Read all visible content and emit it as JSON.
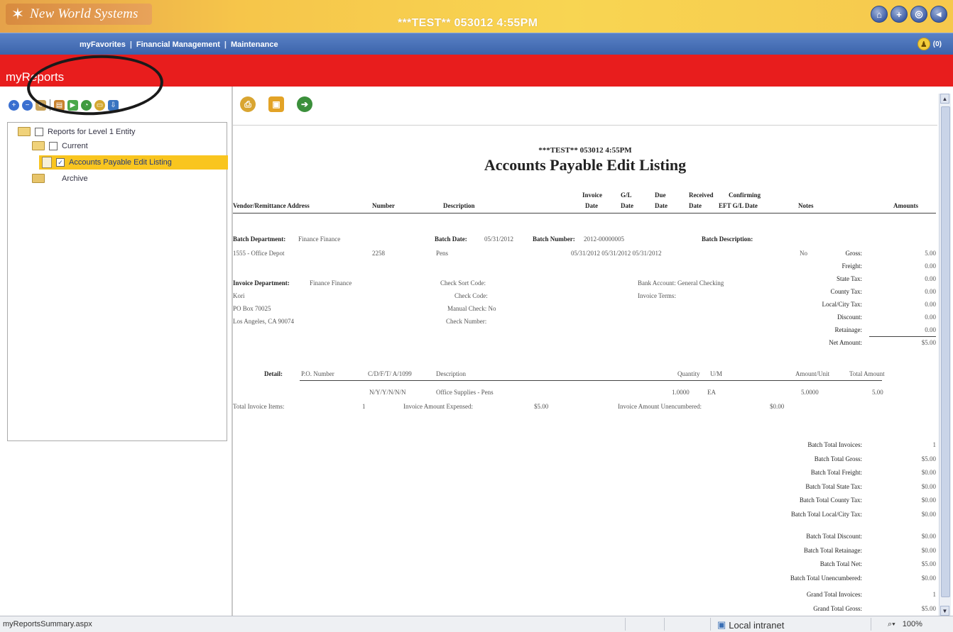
{
  "app": {
    "logo_text": "New World Systems",
    "banner_title": "***TEST** 053012 4:55PM",
    "top_icons": [
      "home-icon",
      "add-icon",
      "globe-icon",
      "back-icon"
    ]
  },
  "nav": {
    "links": [
      "myFavorites",
      "Financial Management",
      "Maintenance"
    ],
    "separator": "|",
    "badge_count": "(0)"
  },
  "section_title": "myReports",
  "tree": {
    "root_label": "Reports for Level 1 Entity",
    "current_label": "Current",
    "selected_report": "Accounts Payable Edit Listing",
    "archive_label": "Archive"
  },
  "report": {
    "test_stamp": "***TEST** 053012 4:55PM",
    "title": "Accounts Payable Edit Listing",
    "columns": {
      "vendor": "Vendor/Remittance Address",
      "number": "Number",
      "description": "Description",
      "invoice_date_1": "Invoice",
      "invoice_date_2": "Date",
      "gl_date_1": "G/L",
      "gl_date_2": "Date",
      "due_date_1": "Due",
      "due_date_2": "Date",
      "received_1": "Received",
      "received_2": "Date",
      "confirming_1": "Confirming",
      "confirming_2": "EFT G/L Date",
      "notes": "Notes",
      "amounts": "Amounts"
    },
    "batch": {
      "department_label": "Batch Department:",
      "department_value": "Finance Finance",
      "date_label": "Batch Date:",
      "date_value": "05/31/2012",
      "number_label": "Batch Number:",
      "number_value": "2012-00000005",
      "description_label": "Batch Description:"
    },
    "invoice_line": {
      "vendor": "1555 - Office Depot",
      "number": "2258",
      "description": "Pens",
      "dates": "05/31/2012  05/31/2012  05/31/2012",
      "notes": "No"
    },
    "amount_labels": [
      "Gross:",
      "Freight:",
      "State Tax:",
      "County Tax:",
      "Local/City Tax:",
      "Discount:",
      "Retainage:",
      "Net Amount:"
    ],
    "amount_values": [
      "5.00",
      "0.00",
      "0.00",
      "0.00",
      "0.00",
      "0.00",
      "0.00",
      "$5.00"
    ],
    "invoice_info": {
      "department_label": "Invoice Department:",
      "department_value": "Finance Finance",
      "address_lines": [
        "Kori",
        "PO Box 70025",
        "Los Angeles, CA 90074"
      ],
      "check_sort_code": "Check Sort Code:",
      "check_code": "Check Code:",
      "manual_check": "Manual Check: No",
      "check_number": "Check Number:",
      "bank_account": "Bank Account: General Checking",
      "invoice_terms": "Invoice Terms:"
    },
    "detail": {
      "label": "Detail:",
      "headers": [
        "P.O. Number",
        "C/D/F/T/ A/1099",
        "Description",
        "Quantity",
        "U/M",
        "Amount/Unit",
        "Total Amount"
      ],
      "row": [
        "",
        "N/Y/Y/N/N/N",
        "Office Supplies - Pens",
        "1.0000",
        "EA",
        "5.0000",
        "5.00"
      ]
    },
    "invoice_totals": {
      "items_label": "Total Invoice Items:",
      "items_value": "1",
      "expensed_label": "Invoice Amount Expensed:",
      "expensed_value": "$5.00",
      "unencumbered_label": "Invoice Amount Unencumbered:",
      "unencumbered_value": "$0.00"
    },
    "batch_totals": [
      {
        "label": "Batch Total Invoices:",
        "value": "1"
      },
      {
        "label": "Batch Total Gross:",
        "value": "$5.00"
      },
      {
        "label": "Batch Total Freight:",
        "value": "$0.00"
      },
      {
        "label": "Batch Total State Tax:",
        "value": "$0.00"
      },
      {
        "label": "Batch Total County Tax:",
        "value": "$0.00"
      },
      {
        "label": "Batch Total Local/City Tax:",
        "value": "$0.00"
      },
      {
        "label": "Batch Total Discount:",
        "value": "$0.00"
      },
      {
        "label": "Batch Total Retainage:",
        "value": "$0.00"
      },
      {
        "label": "Batch Total Net:",
        "value": "$5.00"
      },
      {
        "label": "Batch Total Unencumbered:",
        "value": "$0.00"
      },
      {
        "label": "Grand Total Invoices:",
        "value": "1"
      },
      {
        "label": "Grand Total Gross:",
        "value": "$5.00"
      }
    ]
  },
  "status": {
    "left_text": "myReportsSummary.aspx",
    "zone": "Local intranet",
    "zoom": "100%"
  },
  "colors": {
    "banner": "#f8d552",
    "nav": "#3b64ab",
    "red_bar": "#e81d1d",
    "selection": "#f9c51f"
  }
}
